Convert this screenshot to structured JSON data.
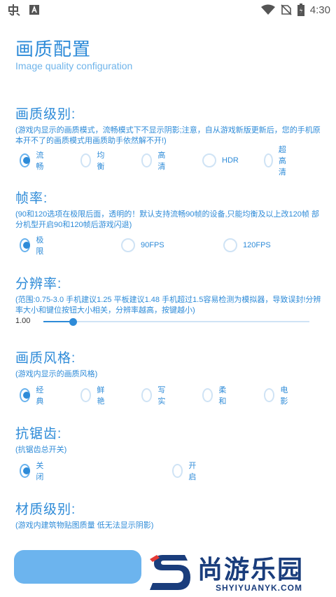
{
  "status_bar": {
    "time": "4:30",
    "icons": [
      "app-notification-icon",
      "text-notification-icon",
      "wifi-icon",
      "no-sim-icon",
      "battery-charging-icon"
    ]
  },
  "header": {
    "title": "画质配置",
    "subtitle": "Image quality configuration"
  },
  "quality_level": {
    "title": "画质级别:",
    "desc": "(游戏内显示的画质模式，流畅模式下不显示阴影;注意，自从游戏新版更新后，您的手机原本开不了的画质模式用画质助手依然解不开!)",
    "options": [
      "流畅",
      "均衡",
      "高清",
      "HDR",
      "超高清"
    ],
    "selected": "流畅"
  },
  "frame_rate": {
    "title": "帧率:",
    "desc": "(90和120选项在极限后面，透明的！默认支持流畅90帧的设备,只能均衡及以上改120帧  部分机型开启90和120帧后游戏闪退)",
    "options": [
      "极限",
      "90FPS",
      "120FPS"
    ],
    "selected": "极限"
  },
  "resolution": {
    "title": "分辨率:",
    "desc": "(范围:0.75-3.0  手机建议1.25 平板建议1.48  手机超过1.5容易检测为模拟器，导致误封!分辨率大小和键位按钮大小相关，分辨率越高，按键越小)",
    "value": "1.00",
    "min": 0.75,
    "max": 3.0,
    "current": 1.0
  },
  "style": {
    "title": "画质风格:",
    "desc": "(游戏内显示的画质风格)",
    "options": [
      "经典",
      "鲜艳",
      "写实",
      "柔和",
      "电影"
    ],
    "selected": "经典"
  },
  "antialias": {
    "title": "抗锯齿:",
    "desc": "(抗锯齿总开关)",
    "options": [
      "关闭",
      "开启"
    ],
    "selected": "关闭"
  },
  "material": {
    "title": "材质级别:",
    "desc": "(游戏内建筑物贴图质量 低无法显示阴影)"
  },
  "watermark": {
    "text": "尚游乐园",
    "url": "SHYIYUANYK.COM"
  },
  "colors": {
    "accent": "#2e8bd8",
    "button": "#6cb4ee",
    "watermark": "#1a3d7c"
  }
}
